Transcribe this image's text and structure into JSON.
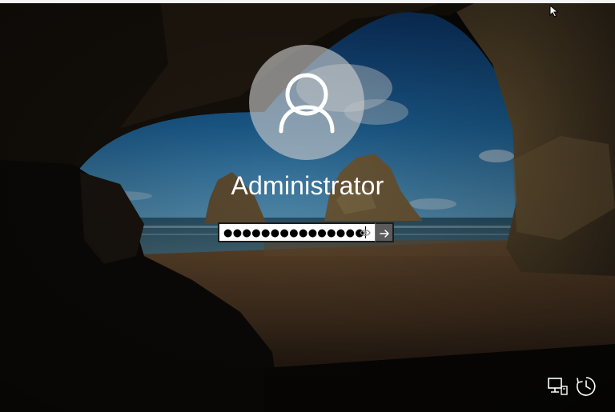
{
  "login": {
    "username": "Administrator",
    "password_masked": "●●●●●●●●●●●●●●●"
  },
  "icons": {
    "avatar": "user-icon",
    "reveal": "eye-icon",
    "submit": "arrow-right-icon",
    "network": "network-icon",
    "ease_of_access": "ease-of-access-icon",
    "cursor": "mouse-pointer-icon"
  },
  "colors": {
    "avatar_circle": "#cdcdcd",
    "submit_button": "#5b5b5b",
    "text": "#ffffff"
  }
}
